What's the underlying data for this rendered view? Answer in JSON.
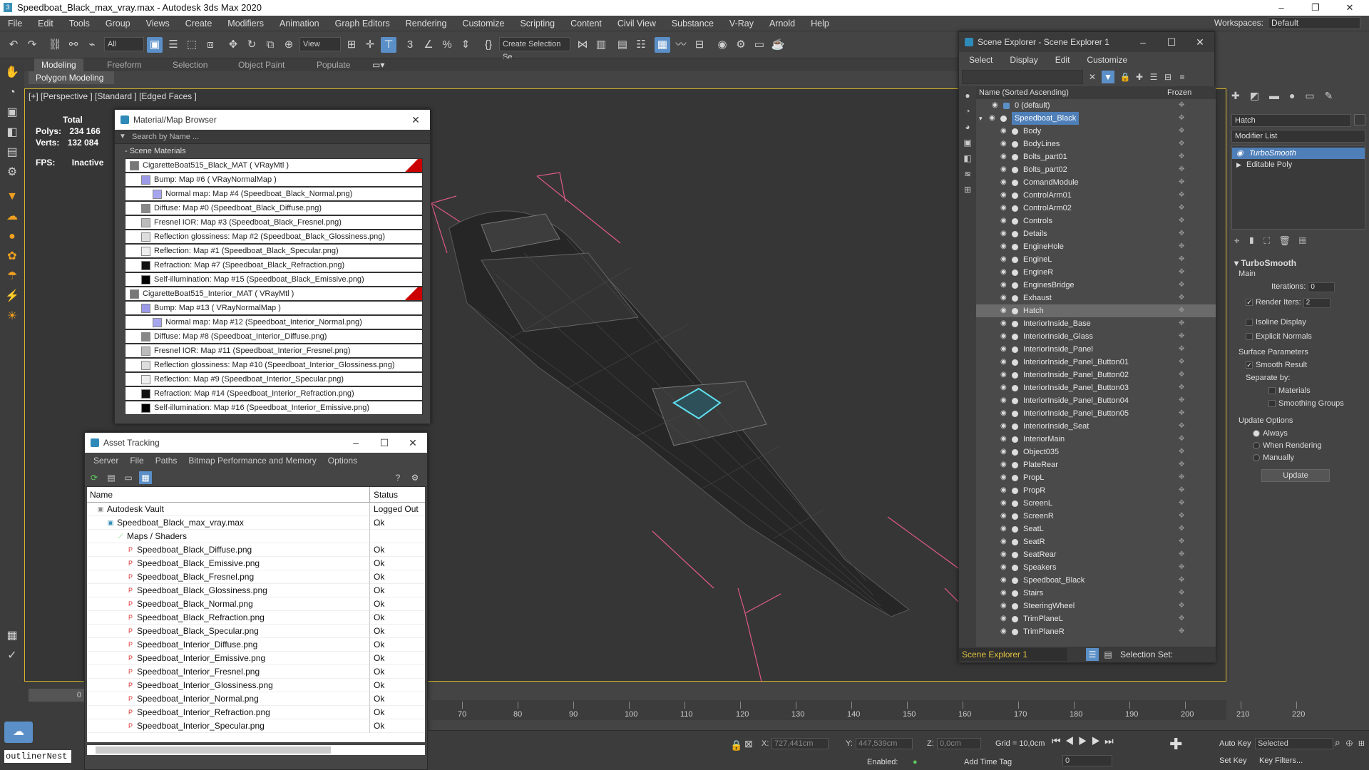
{
  "window": {
    "title": "Speedboat_Black_max_vray.max - Autodesk 3ds Max 2020",
    "minimize": "–",
    "maximize": "❐",
    "close": "✕"
  },
  "menubar": [
    "File",
    "Edit",
    "Tools",
    "Group",
    "Views",
    "Create",
    "Modifiers",
    "Animation",
    "Graph Editors",
    "Rendering",
    "Customize",
    "Scripting",
    "Content",
    "Civil View",
    "Substance",
    "V-Ray",
    "Arnold",
    "Help"
  ],
  "workspaces": {
    "label": "Workspaces:",
    "value": "Default"
  },
  "toolbar": {
    "filter": "All",
    "view": "View",
    "selection_set": "Create Selection Se"
  },
  "ribbon": {
    "tabs": [
      "Modeling",
      "Freeform",
      "Selection",
      "Object Paint",
      "Populate"
    ],
    "sub": "Polygon Modeling"
  },
  "viewport": {
    "label": "[+] [Perspective ] [Standard ] [Edged Faces ]",
    "stats": {
      "total": "Total",
      "polys_label": "Polys:",
      "polys": "234 166",
      "verts_label": "Verts:",
      "verts": "132 084",
      "fps_label": "FPS:",
      "fps": "Inactive"
    }
  },
  "mat_browser": {
    "title": "Material/Map Browser",
    "search_placeholder": "Search by Name ...",
    "group": "- Scene Materials",
    "rows": [
      {
        "indent": 0,
        "text": "CigaretteBoat515_Black_MAT  ( VRayMtl )",
        "swatch": "#777",
        "red": true
      },
      {
        "indent": 1,
        "text": "Bump: Map #6  ( VRayNormalMap )",
        "swatch": "#9a9ae8"
      },
      {
        "indent": 2,
        "text": "Normal map: Map #4 (Speedboat_Black_Normal.png)",
        "swatch": "#a6a6ee"
      },
      {
        "indent": 1,
        "text": "Diffuse: Map #0 (Speedboat_Black_Diffuse.png)",
        "swatch": "#888"
      },
      {
        "indent": 1,
        "text": "Fresnel IOR: Map #3 (Speedboat_Black_Fresnel.png)",
        "swatch": "#bbb"
      },
      {
        "indent": 1,
        "text": "Reflection glossiness: Map #2 (Speedboat_Black_Glossiness.png)",
        "swatch": "#ddd"
      },
      {
        "indent": 1,
        "text": "Reflection: Map #1 (Speedboat_Black_Specular.png)",
        "swatch": "#eee"
      },
      {
        "indent": 1,
        "text": "Refraction: Map #7 (Speedboat_Black_Refraction.png)",
        "swatch": "#111"
      },
      {
        "indent": 1,
        "text": "Self-illumination: Map #15 (Speedboat_Black_Emissive.png)",
        "swatch": "#000"
      },
      {
        "indent": 0,
        "text": "CigaretteBoat515_Interior_MAT  ( VRayMtl )",
        "swatch": "#777",
        "red": true
      },
      {
        "indent": 1,
        "text": "Bump: Map #13  ( VRayNormalMap )",
        "swatch": "#9a9ae8"
      },
      {
        "indent": 2,
        "text": "Normal map: Map #12 (Speedboat_Interior_Normal.png)",
        "swatch": "#a6a6ee"
      },
      {
        "indent": 1,
        "text": "Diffuse: Map #8 (Speedboat_Interior_Diffuse.png)",
        "swatch": "#888"
      },
      {
        "indent": 1,
        "text": "Fresnel IOR: Map #11 (Speedboat_Interior_Fresnel.png)",
        "swatch": "#bbb"
      },
      {
        "indent": 1,
        "text": "Reflection glossiness: Map #10 (Speedboat_Interior_Glossiness.png)",
        "swatch": "#ddd"
      },
      {
        "indent": 1,
        "text": "Reflection: Map #9 (Speedboat_Interior_Specular.png)",
        "swatch": "#eee"
      },
      {
        "indent": 1,
        "text": "Refraction: Map #14 (Speedboat_Interior_Refraction.png)",
        "swatch": "#111"
      },
      {
        "indent": 1,
        "text": "Self-illumination: Map #16 (Speedboat_Interior_Emissive.png)",
        "swatch": "#000"
      }
    ]
  },
  "asset_tracking": {
    "title": "Asset Tracking",
    "menu": [
      "Server",
      "File",
      "Paths",
      "Bitmap Performance and Memory",
      "Options"
    ],
    "col_name": "Name",
    "col_status": "Status",
    "rows": [
      {
        "indent": 1,
        "name": "Autodesk Vault",
        "status": "Logged Out ...",
        "icon": "vault"
      },
      {
        "indent": 2,
        "name": "Speedboat_Black_max_vray.max",
        "status": "Ok",
        "icon": "max"
      },
      {
        "indent": 3,
        "name": "Maps / Shaders",
        "status": "",
        "icon": "folder"
      },
      {
        "indent": 4,
        "name": "Speedboat_Black_Diffuse.png",
        "status": "Ok",
        "icon": "png"
      },
      {
        "indent": 4,
        "name": "Speedboat_Black_Emissive.png",
        "status": "Ok",
        "icon": "png"
      },
      {
        "indent": 4,
        "name": "Speedboat_Black_Fresnel.png",
        "status": "Ok",
        "icon": "png"
      },
      {
        "indent": 4,
        "name": "Speedboat_Black_Glossiness.png",
        "status": "Ok",
        "icon": "png"
      },
      {
        "indent": 4,
        "name": "Speedboat_Black_Normal.png",
        "status": "Ok",
        "icon": "png"
      },
      {
        "indent": 4,
        "name": "Speedboat_Black_Refraction.png",
        "status": "Ok",
        "icon": "png"
      },
      {
        "indent": 4,
        "name": "Speedboat_Black_Specular.png",
        "status": "Ok",
        "icon": "png"
      },
      {
        "indent": 4,
        "name": "Speedboat_Interior_Diffuse.png",
        "status": "Ok",
        "icon": "png"
      },
      {
        "indent": 4,
        "name": "Speedboat_Interior_Emissive.png",
        "status": "Ok",
        "icon": "png"
      },
      {
        "indent": 4,
        "name": "Speedboat_Interior_Fresnel.png",
        "status": "Ok",
        "icon": "png"
      },
      {
        "indent": 4,
        "name": "Speedboat_Interior_Glossiness.png",
        "status": "Ok",
        "icon": "png"
      },
      {
        "indent": 4,
        "name": "Speedboat_Interior_Normal.png",
        "status": "Ok",
        "icon": "png"
      },
      {
        "indent": 4,
        "name": "Speedboat_Interior_Refraction.png",
        "status": "Ok",
        "icon": "png"
      },
      {
        "indent": 4,
        "name": "Speedboat_Interior_Specular.png",
        "status": "Ok",
        "icon": "png"
      }
    ]
  },
  "scene_explorer": {
    "title": "Scene Explorer - Scene Explorer 1",
    "menu": [
      "Select",
      "Display",
      "Edit",
      "Customize"
    ],
    "col_name": "Name (Sorted Ascending)",
    "col_frozen": "Frozen",
    "root": "0 (default)",
    "group": "Speedboat_Black",
    "items": [
      "Body",
      "BodyLines",
      "Bolts_part01",
      "Bolts_part02",
      "ComandModule",
      "ControlArm01",
      "ControlArm02",
      "Controls",
      "Details",
      "EngineHole",
      "EngineL",
      "EngineR",
      "EnginesBridge",
      "Exhaust",
      "Hatch",
      "InteriorInside_Base",
      "InteriorInside_Glass",
      "InteriorInside_Panel",
      "InteriorInside_Panel_Button01",
      "InteriorInside_Panel_Button02",
      "InteriorInside_Panel_Button03",
      "InteriorInside_Panel_Button04",
      "InteriorInside_Panel_Button05",
      "InteriorInside_Seat",
      "InteriorMain",
      "Object035",
      "PlateRear",
      "PropL",
      "PropR",
      "ScreenL",
      "ScreenR",
      "SeatL",
      "SeatR",
      "SeatRear",
      "Speakers",
      "Speedboat_Black",
      "Stairs",
      "SteeringWheel",
      "TrimPlaneL",
      "TrimPlaneR"
    ],
    "highlighted": "Hatch",
    "footer_explorer": "Scene Explorer 1",
    "footer_selset": "Selection Set:"
  },
  "command_panel": {
    "object_name": "Hatch",
    "modifier_list": "Modifier List",
    "stack": [
      "TurboSmooth",
      "Editable Poly"
    ],
    "rollout": "TurboSmooth",
    "main": "Main",
    "iterations_label": "Iterations:",
    "iterations": "0",
    "render_iters_label": "Render Iters:",
    "render_iters": "2",
    "isoline": "Isoline Display",
    "explicit": "Explicit Normals",
    "surface": "Surface Parameters",
    "smooth": "Smooth Result",
    "separate": "Separate by:",
    "materials": "Materials",
    "smoothing": "Smoothing Groups",
    "update_opts": "Update Options",
    "always": "Always",
    "when_rendering": "When Rendering",
    "manually": "Manually",
    "update_btn": "Update"
  },
  "timeline": {
    "ticks": [
      "70",
      "80",
      "90",
      "100",
      "110",
      "120",
      "130",
      "140",
      "150",
      "160",
      "170",
      "180",
      "190",
      "200",
      "210",
      "220"
    ],
    "frame": "0"
  },
  "status": {
    "x_label": "X:",
    "x": "727,441cm",
    "y_label": "Y:",
    "y": "447,539cm",
    "z_label": "Z:",
    "z": "0,0cm",
    "grid": "Grid = 10,0cm",
    "enabled": "Enabled:",
    "add_time_tag": "Add Time Tag",
    "auto_key": "Auto Key",
    "selected": "Selected",
    "set_key": "Set Key",
    "key_filters": "Key Filters...",
    "frame": "0",
    "maxscript": "outlinerNest"
  },
  "colors": {
    "accent": "#5b8fc7",
    "viewport_border": "#d6b52a",
    "boat": "#2a2a2a",
    "wire_pink": "#e05a8a",
    "hatch_cyan": "#5fe0f0"
  }
}
